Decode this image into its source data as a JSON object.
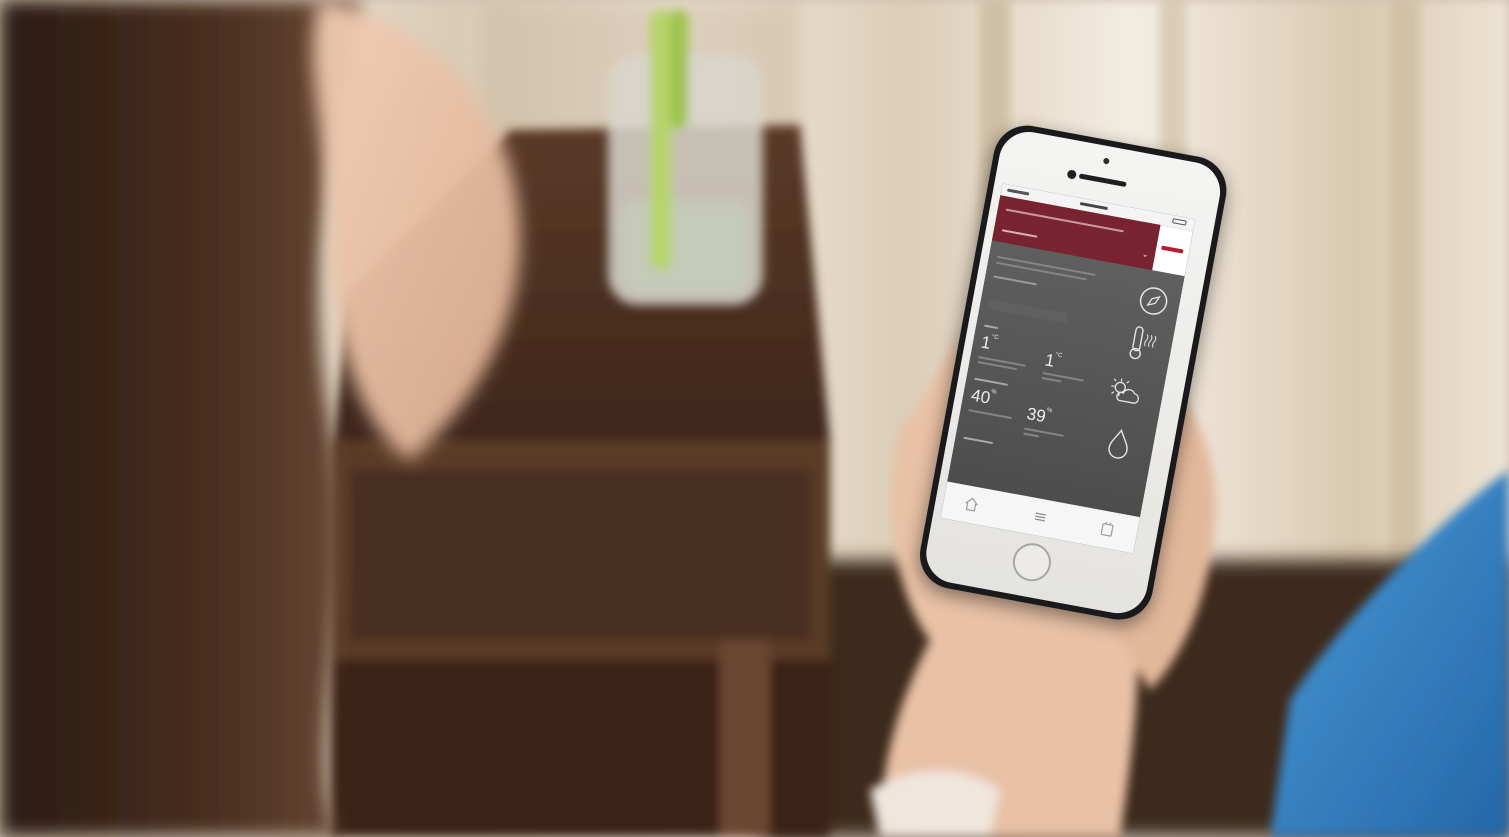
{
  "scene": {
    "colors": {
      "curtain": "#e8dccb",
      "wood": "#4a2e1f",
      "hair": "#3a2418",
      "skin": "#e9c2a8",
      "chair": "#2f7fc2",
      "app_header": "#7a2330",
      "app_content": "#555555"
    }
  },
  "phone": {
    "status": {
      "carrier": "",
      "time": "",
      "battery": ""
    },
    "header": {
      "title": "",
      "subtitle": ""
    },
    "readings": [
      {
        "value": "1",
        "unit": "°C"
      },
      {
        "value": "1",
        "unit": "°C"
      },
      {
        "value": "40",
        "unit": "%"
      },
      {
        "value": "39",
        "unit": "%"
      }
    ],
    "icons": [
      "compass-icon",
      "thermometer-icon",
      "weather-icon",
      "droplet-icon"
    ],
    "tabs": [
      "home-tab-icon",
      "menu-tab-icon",
      "settings-tab-icon"
    ]
  }
}
